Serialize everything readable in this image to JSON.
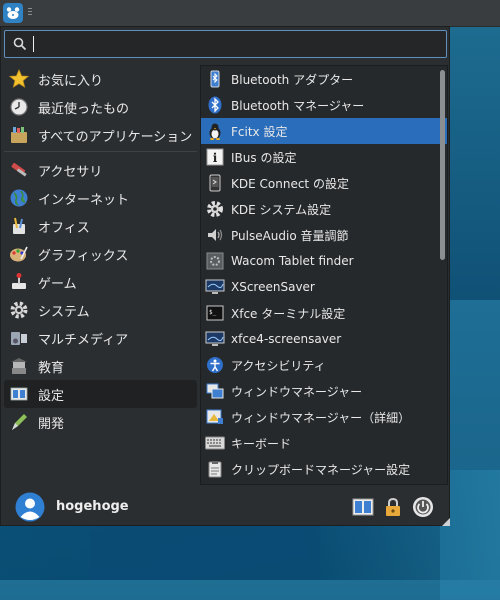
{
  "panel": {
    "menu_icon": "mouse-logo-icon"
  },
  "search": {
    "value": "",
    "placeholder": ""
  },
  "categories": [
    {
      "label": "お気に入り",
      "icon": "star-icon"
    },
    {
      "label": "最近使ったもの",
      "icon": "clock-icon"
    },
    {
      "label": "すべてのアプリケーション",
      "icon": "all-apps-icon"
    },
    {
      "label": "アクセサリ",
      "icon": "accessories-icon"
    },
    {
      "label": "インターネット",
      "icon": "globe-icon"
    },
    {
      "label": "オフィス",
      "icon": "office-icon"
    },
    {
      "label": "グラフィックス",
      "icon": "graphics-icon"
    },
    {
      "label": "ゲーム",
      "icon": "game-icon"
    },
    {
      "label": "システム",
      "icon": "system-gear-icon"
    },
    {
      "label": "マルチメディア",
      "icon": "multimedia-icon"
    },
    {
      "label": "教育",
      "icon": "education-icon"
    },
    {
      "label": "設定",
      "icon": "settings-icon"
    },
    {
      "label": "開発",
      "icon": "development-icon"
    }
  ],
  "apps": [
    {
      "label": "Bluetooth アダプター",
      "icon": "bluetooth-adapter-icon"
    },
    {
      "label": "Bluetooth マネージャー",
      "icon": "bluetooth-icon"
    },
    {
      "label": "Fcitx 設定",
      "icon": "penguin-icon"
    },
    {
      "label": "IBus の設定",
      "icon": "info-icon"
    },
    {
      "label": "KDE Connect の設定",
      "icon": "phone-icon"
    },
    {
      "label": "KDE システム設定",
      "icon": "gear-icon"
    },
    {
      "label": "PulseAudio 音量調節",
      "icon": "speaker-icon"
    },
    {
      "label": "Wacom Tablet finder",
      "icon": "tablet-icon"
    },
    {
      "label": "XScreenSaver",
      "icon": "monitor-icon"
    },
    {
      "label": "Xfce ターミナル設定",
      "icon": "terminal-icon"
    },
    {
      "label": "xfce4-screensaver",
      "icon": "monitor-icon"
    },
    {
      "label": "アクセシビリティ",
      "icon": "accessibility-icon"
    },
    {
      "label": "ウィンドウマネージャー",
      "icon": "window-manager-icon"
    },
    {
      "label": "ウィンドウマネージャー（詳細）",
      "icon": "window-manager-tweaks-icon"
    },
    {
      "label": "キーボード",
      "icon": "keyboard-icon"
    },
    {
      "label": "クリップボードマネージャー設定",
      "icon": "clipboard-icon"
    }
  ],
  "selected_category": "設定",
  "selected_app": "Fcitx 設定",
  "user": {
    "name": "hogehoge"
  },
  "colors": {
    "accent": "#2a6dbb",
    "panel": "#3a3d40",
    "menu_bg": "#2b2e31"
  }
}
